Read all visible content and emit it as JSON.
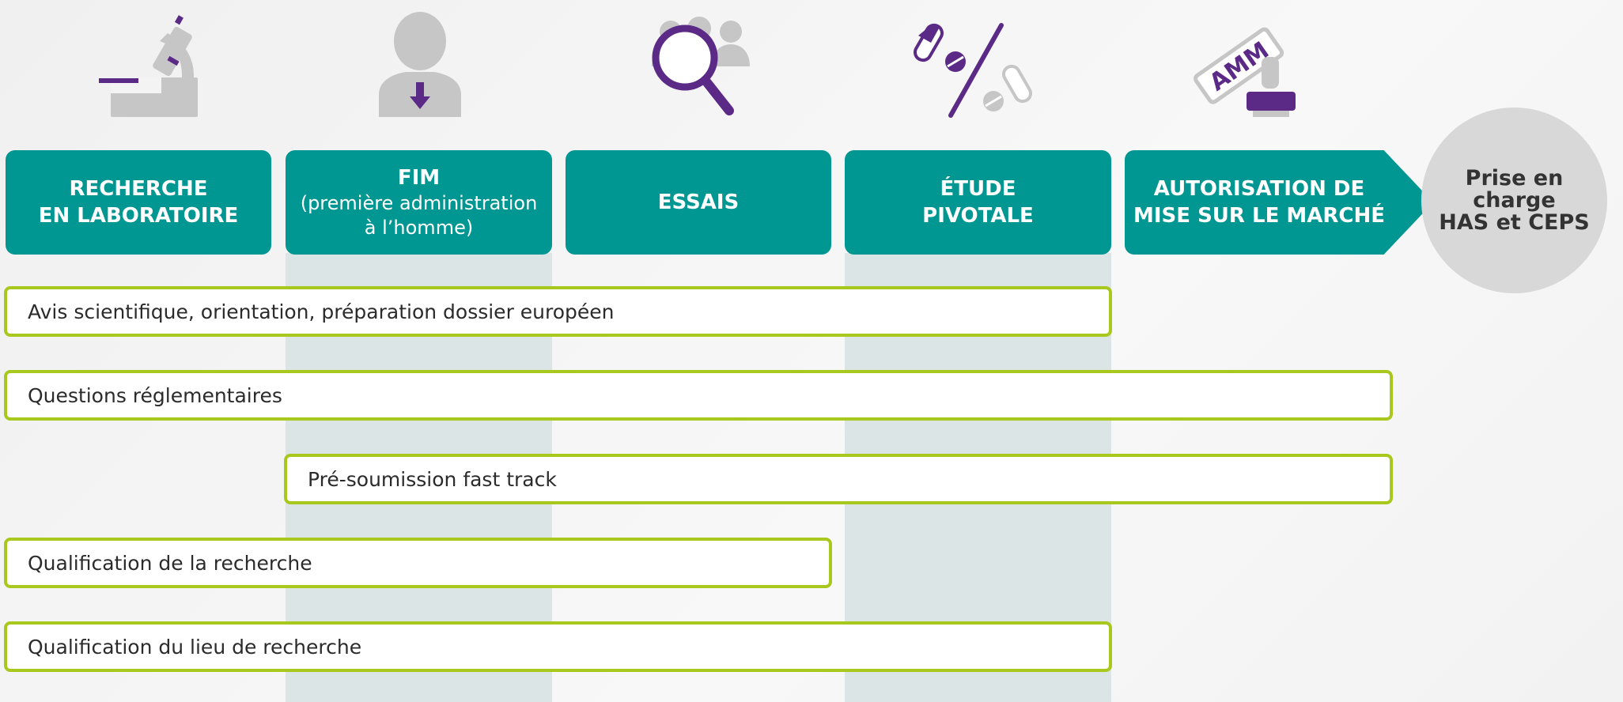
{
  "colors": {
    "stage_bg": "#009691",
    "bar_border": "#a9c81e",
    "band": "#dbe5e5",
    "icon_gray": "#c6c6c6",
    "icon_purple": "#5b2a86",
    "circle": "#d8d8d8"
  },
  "icons": [
    "microscope-icon",
    "person-arrow-icon",
    "magnifier-group-icon",
    "pills-icon",
    "amm-stamp-icon"
  ],
  "stages": [
    {
      "lines": [
        "RECHERCHE",
        "EN LABORATOIRE"
      ]
    },
    {
      "title": "FIM",
      "sub": [
        "(première administration",
        "à l’homme)"
      ]
    },
    {
      "lines": [
        "ESSAIS"
      ]
    },
    {
      "lines": [
        "ÉTUDE",
        "PIVOTALE"
      ]
    },
    {
      "lines": [
        "AUTORISATION DE",
        "MISE SUR LE MARCHÉ"
      ]
    }
  ],
  "final": {
    "lines": [
      "Prise en charge",
      "HAS et CEPS"
    ]
  },
  "services": [
    {
      "label": "Avis scientifique, orientation, préparation dossier européen"
    },
    {
      "label": "Questions réglementaires"
    },
    {
      "label": "Pré-soumission fast track"
    },
    {
      "label": "Qualification de la recherche"
    },
    {
      "label": "Qualification du lieu de recherche"
    }
  ]
}
